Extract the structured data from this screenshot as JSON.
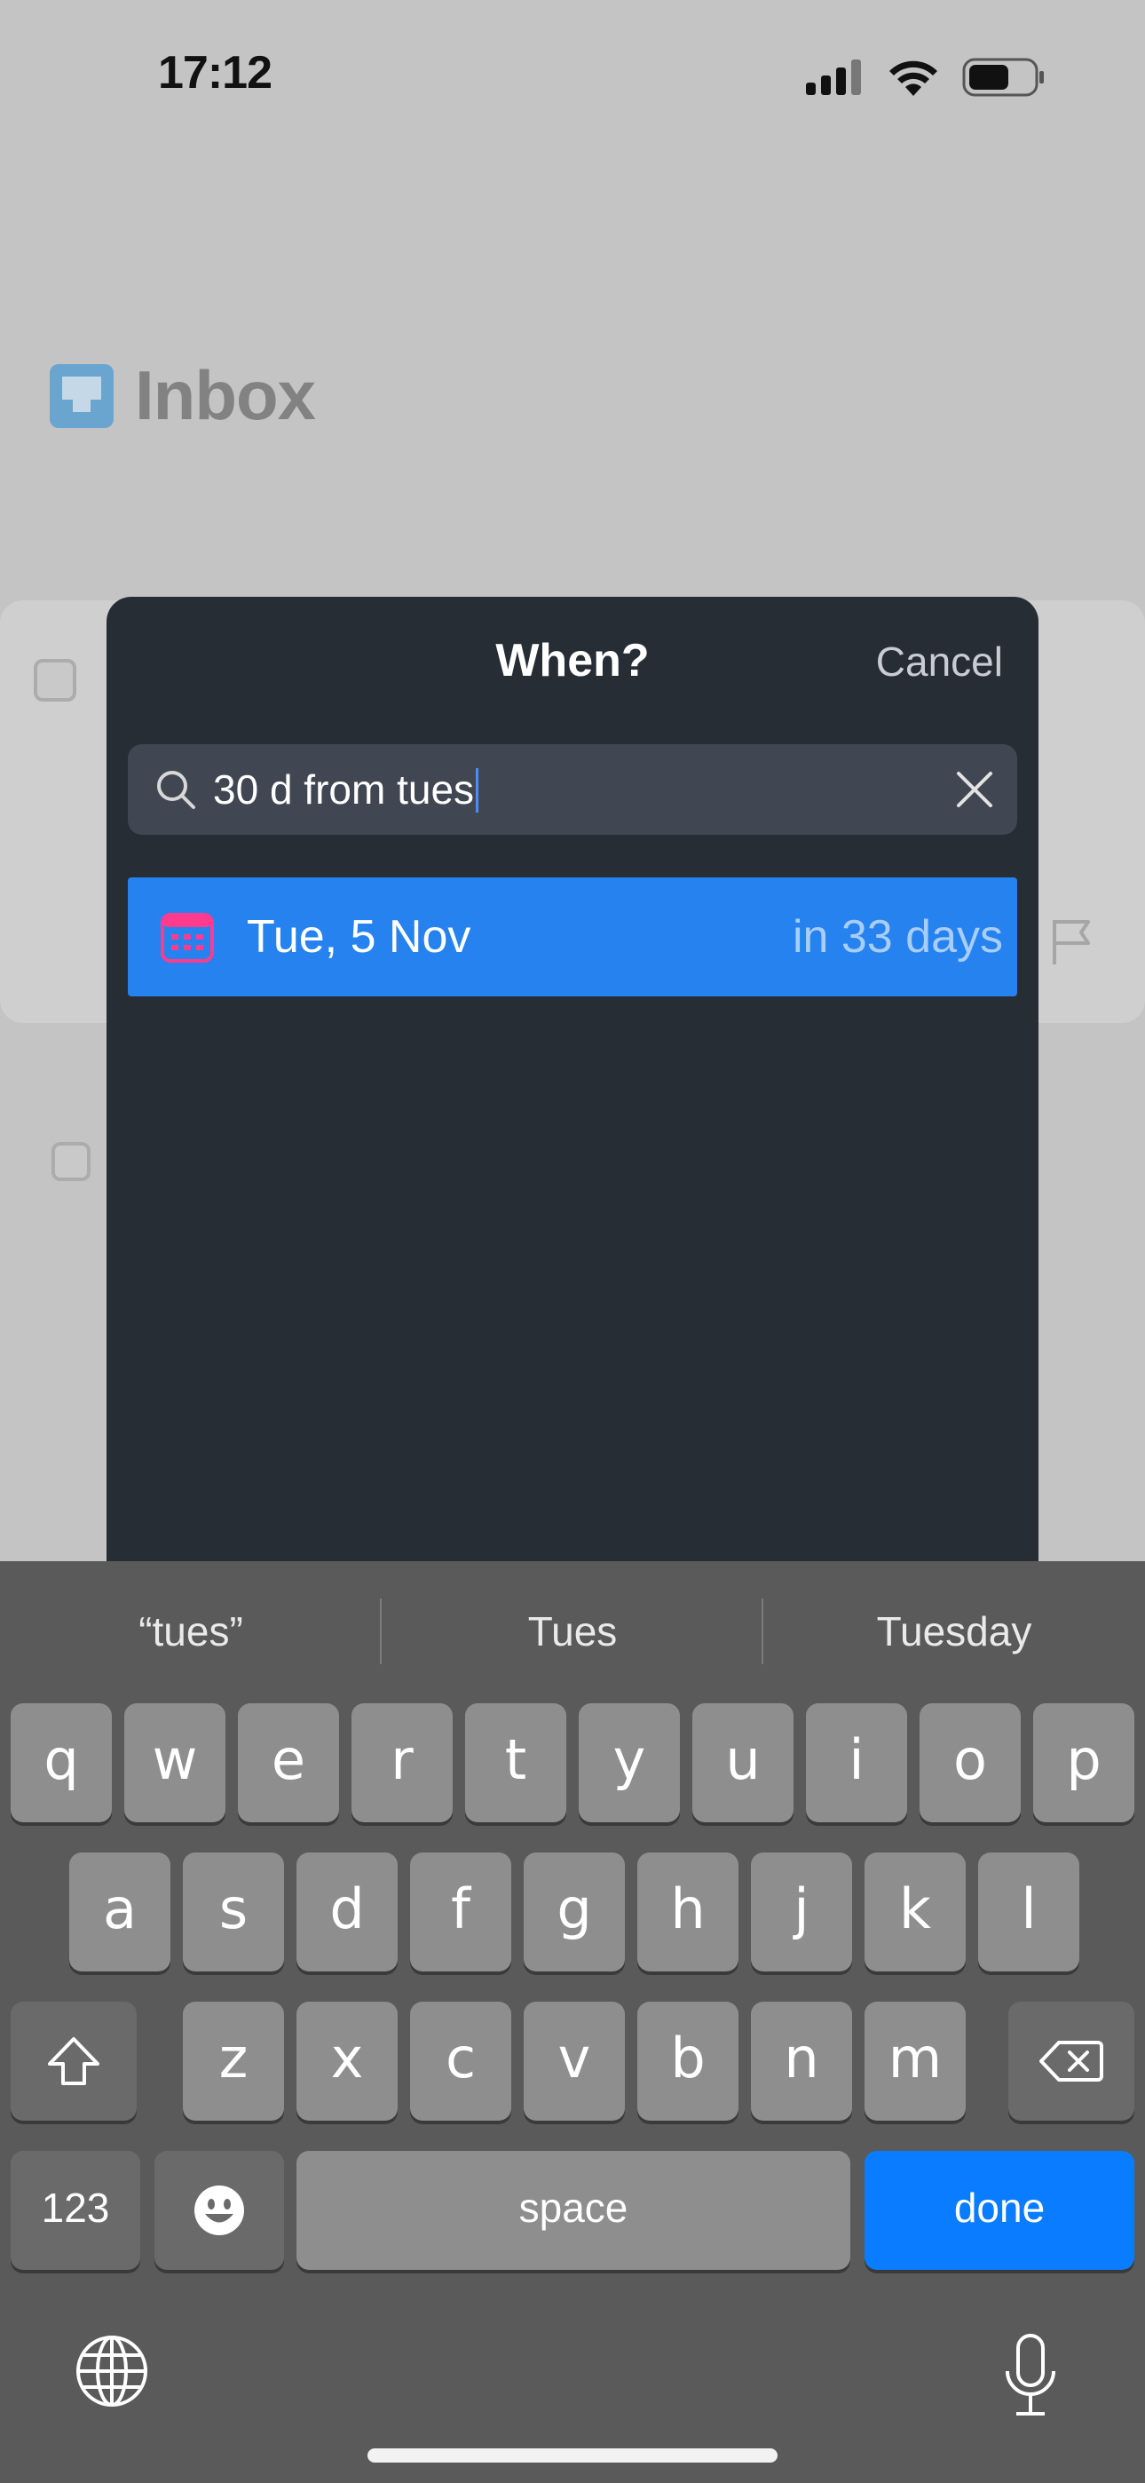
{
  "status_bar": {
    "time": "17:12"
  },
  "background": {
    "title": "Inbox",
    "accent_color": "#4aa3e8"
  },
  "sheet": {
    "title": "When?",
    "cancel_label": "Cancel",
    "search": {
      "value": "30 d from tues"
    },
    "results": [
      {
        "date_label": "Tue, 5 Nov",
        "relative_label": "in 33 days",
        "icon": "calendar-icon"
      }
    ]
  },
  "keyboard": {
    "suggestions": [
      "“tues”",
      "Tues",
      "Tuesday"
    ],
    "row1": [
      "q",
      "w",
      "e",
      "r",
      "t",
      "y",
      "u",
      "i",
      "o",
      "p"
    ],
    "row2": [
      "a",
      "s",
      "d",
      "f",
      "g",
      "h",
      "j",
      "k",
      "l"
    ],
    "row3": [
      "z",
      "x",
      "c",
      "v",
      "b",
      "n",
      "m"
    ],
    "numbers_label": "123",
    "space_label": "space",
    "done_label": "done",
    "done_color": "#0a7cff"
  }
}
